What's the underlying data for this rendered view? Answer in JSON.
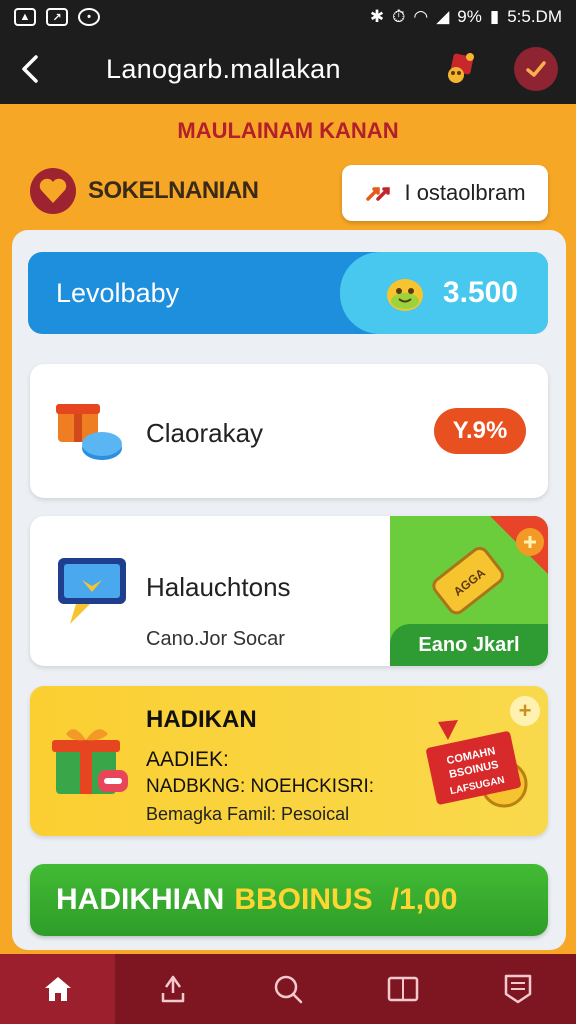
{
  "status_bar": {
    "time": "5:5.DM",
    "battery": "9%"
  },
  "app_bar": {
    "title": "Lanogarb.mallakan"
  },
  "header": {
    "promo_title": "MAULAINAM KANAN",
    "brand_label": "SOKELNANIAN",
    "install_button": "I ostaolbram"
  },
  "level": {
    "label": "Levolbaby",
    "value": "3.500"
  },
  "daily_card": {
    "title": "Claorakay",
    "badge": "Y.9%"
  },
  "hal_card": {
    "title": "Halauchtons",
    "subtitle": "Cano.Jor Socar",
    "promo_button": "Eano Jkarl",
    "promo_tag": "AGGA"
  },
  "bonus_card": {
    "heading": "HADIKAN",
    "line1": "AADIEK:",
    "line2": "NADBKNG: NOEHCKISRI:",
    "line3": "Bemagka Famil: Pesoical",
    "sticker_line1": "COMAHN",
    "sticker_line2": "BSOINUS",
    "sticker_line3": "LAFSUGAN"
  },
  "cta": {
    "label_part1": "HADIKHIAN",
    "label_part2": "BBOINUS",
    "amount": "/1,00"
  },
  "colors": {
    "background": "#f7a726",
    "app_bar": "#1d1d1d",
    "accent_red": "#b3202c",
    "level_blue": "#1e8fdc",
    "cta_green": "#3aaf30",
    "nav_maroon": "#7e1622"
  },
  "bottom_nav": {
    "items": [
      {
        "icon": "home-icon"
      },
      {
        "icon": "upload-icon"
      },
      {
        "icon": "search-icon"
      },
      {
        "icon": "book-icon"
      },
      {
        "icon": "receipt-icon"
      }
    ]
  }
}
